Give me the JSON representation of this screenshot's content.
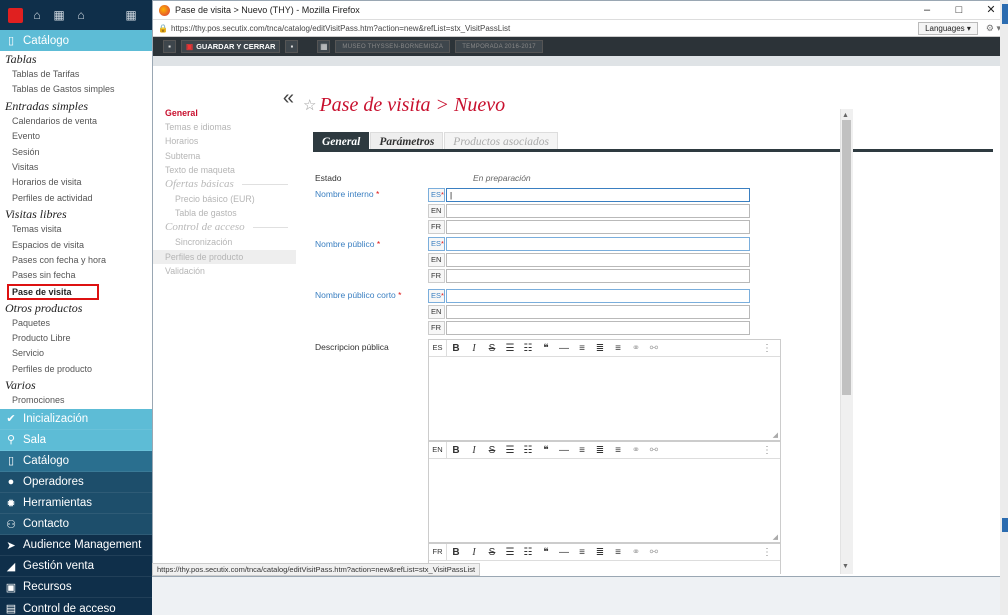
{
  "colors": {
    "sidebar_dark": "#0f2f4a",
    "sidebar_mid": "#1d4e6b",
    "sidebar_light": "#5dbcd6",
    "accent_red": "#c8102e"
  },
  "app_sidebar": {
    "top_icons": [
      "red-square-icon",
      "bank-icon",
      "building-icon",
      "home-icon",
      "building-icon"
    ],
    "section_title": "Catálogo",
    "groups": [
      {
        "title": "Tablas",
        "items": [
          "Tablas de Tarifas",
          "Tablas de Gastos simples"
        ]
      },
      {
        "title": "Entradas simples",
        "items": [
          "Calendarios de venta",
          "Evento",
          "Sesión",
          "Visitas",
          "Horarios de visita",
          "Perfiles de actividad"
        ]
      },
      {
        "title": "Visitas libres",
        "items": [
          "Temas visita",
          "Espacios de visita",
          "Pases con fecha y hora",
          "Pases sin fecha",
          "Pase de visita"
        ]
      },
      {
        "title": "Otros productos",
        "items": [
          "Paquetes",
          "Producto Libre",
          "Servicio",
          "Perfiles de producto"
        ]
      },
      {
        "title": "Varios",
        "items": [
          "Promociones"
        ]
      }
    ],
    "selected_item": "Pase de visita",
    "categories": [
      {
        "label": "Inicialización",
        "icon": "check-circle-icon"
      },
      {
        "label": "Sala",
        "icon": "map-pin-icon"
      },
      {
        "label": "Catálogo",
        "icon": "book-icon"
      },
      {
        "label": "Operadores",
        "icon": "user-icon"
      },
      {
        "label": "Herramientas",
        "icon": "gear-icon"
      },
      {
        "label": "Contacto",
        "icon": "users-icon"
      },
      {
        "label": "Audience Management",
        "icon": "send-icon"
      },
      {
        "label": "Gestión venta",
        "icon": "chart-icon"
      },
      {
        "label": "Recursos",
        "icon": "resources-icon"
      },
      {
        "label": "Control de acceso",
        "icon": "access-icon"
      }
    ]
  },
  "window": {
    "title": "Pase de visita > Nuevo (THY) - Mozilla Firefox",
    "url": "https://thy.pos.secutix.com/tnca/catalog/editVisitPass.htm?action=new&refList=stx_VisitPassList",
    "languages_button": "Languages",
    "controls": [
      "–",
      "□",
      "✕"
    ]
  },
  "toolbar": {
    "save_close_label": "GUARDAR Y CERRAR",
    "blur1": "MUSEO THYSSEN-BORNEMISZA",
    "blur2": "TEMPORADA 2016-2017"
  },
  "left_panel": {
    "items": [
      {
        "label": "General",
        "type": "item",
        "active": true
      },
      {
        "label": "Temas e idiomas",
        "type": "item"
      },
      {
        "label": "Horarios",
        "type": "item"
      },
      {
        "label": "Subtema",
        "type": "item"
      },
      {
        "label": "Texto de maqueta",
        "type": "item"
      },
      {
        "label": "Ofertas básicas",
        "type": "group"
      },
      {
        "label": "Precio básico (EUR)",
        "type": "sub"
      },
      {
        "label": "Tabla de gastos",
        "type": "sub"
      },
      {
        "label": "Control de acceso",
        "type": "group"
      },
      {
        "label": "Sincronización",
        "type": "sub"
      },
      {
        "label": "Perfiles de producto",
        "type": "item",
        "hl": true
      },
      {
        "label": "Validación",
        "type": "item"
      }
    ]
  },
  "page": {
    "title": "Pase de visita > Nuevo",
    "tabs": [
      "General",
      "Parámetros",
      "Productos asociados"
    ],
    "active_tab": "General"
  },
  "form": {
    "estado_label": "Estado",
    "estado_value": "En preparación",
    "nombre_interno_label": "Nombre interno",
    "nombre_publico_label": "Nombre público",
    "nombre_publico_corto_label": "Nombre público corto",
    "descripcion_label": "Descripcion pública",
    "lang_codes": [
      "ES",
      "EN",
      "FR"
    ]
  },
  "status_url": "https://thy.pos.secutix.com/tnca/catalog/editVisitPass.htm?action=new&refList=stx_VisitPassList"
}
